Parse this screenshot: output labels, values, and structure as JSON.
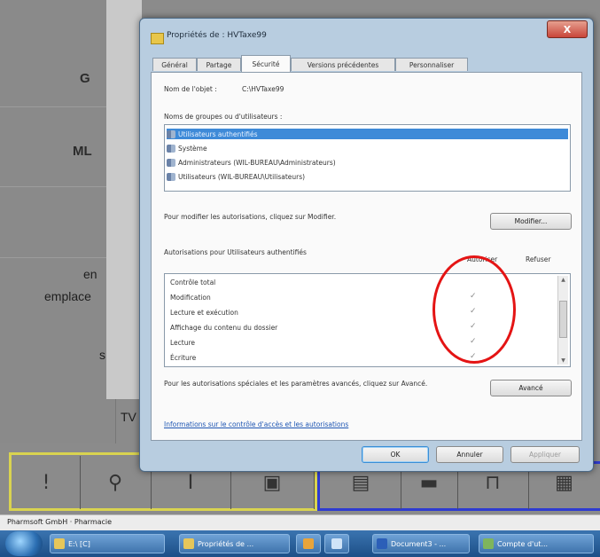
{
  "background_app": {
    "labels": [
      "G",
      "ML",
      "en",
      "emplace",
      "s",
      "TV"
    ],
    "status_text": "Pharmsoft GmbH · Pharmacie",
    "toolbar_icons": [
      "exclamation-icon",
      "pestle-icon",
      "column-icon",
      "document-icon",
      "monitor-icon",
      "dash-icon",
      "bracket-icon",
      "grid-icon"
    ]
  },
  "taskbar": {
    "items": [
      "E:\\ [C]",
      "Propriétés de ...",
      "",
      "",
      "Document3 - ...",
      "Compte d'ut..."
    ]
  },
  "dialog": {
    "title": "Propriétés de : HVTaxe99",
    "close_label": "X",
    "tabs": [
      "Général",
      "Partage",
      "Sécurité",
      "Versions précédentes",
      "Personnaliser"
    ],
    "active_tab": "Sécurité",
    "object_name_label": "Nom de l'objet :",
    "object_name_value": "C:\\HVTaxe99",
    "groups_label": "Noms de groupes ou d'utilisateurs :",
    "groups": [
      "Utilisateurs authentifiés",
      "Système",
      "Administrateurs (WIL-BUREAU\\Administrateurs)",
      "Utilisateurs (WIL-BUREAU\\Utilisateurs)"
    ],
    "selected_group": 0,
    "modify_hint": "Pour modifier les autorisations, cliquez sur Modifier.",
    "modify_button": "Modifier...",
    "permissions_label": "Autorisations pour Utilisateurs authentifiés",
    "allow_header": "Autoriser",
    "deny_header": "Refuser",
    "permissions": [
      {
        "name": "Contrôle total",
        "allow": ""
      },
      {
        "name": "Modification",
        "allow": "✓"
      },
      {
        "name": "Lecture et exécution",
        "allow": "✓"
      },
      {
        "name": "Affichage du contenu du dossier",
        "allow": "✓"
      },
      {
        "name": "Lecture",
        "allow": "✓"
      },
      {
        "name": "Écriture",
        "allow": "✓"
      }
    ],
    "advanced_hint": "Pour les autorisations spéciales et les paramètres avancés, cliquez sur Avancé.",
    "advanced_button": "Avancé",
    "info_link": "Informations sur le contrôle d'accès et les autorisations",
    "ok_button": "OK",
    "cancel_button": "Annuler",
    "apply_button": "Appliquer"
  },
  "colors": {
    "highlight_circle": "#e41414",
    "selection": "#3e8ad8",
    "toolbar_yellow": "#d9d350",
    "toolbar_blue": "#2e3bd1"
  }
}
